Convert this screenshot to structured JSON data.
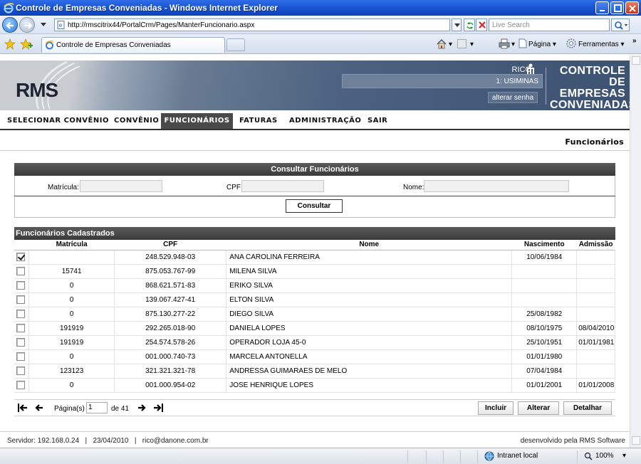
{
  "browser": {
    "window_title": "Controle de Empresas Conveniadas - Windows Internet Explorer",
    "url": "http://rmscitrix44/PortalCrm/Pages/ManterFuncionario.aspx",
    "search_placeholder": "Live Search",
    "tab_label": "Controle de Empresas Conveniadas",
    "cmd_page": "Página",
    "cmd_tools": "Ferramentas",
    "status_zone": "Intranet local",
    "status_zoom": "100%"
  },
  "header": {
    "logo": "RMS",
    "username": "RICO",
    "company": "1: USIMINAS",
    "change_password": "alterar senha",
    "system_name_1": "CONTROLE",
    "system_name_2": "DE EMPRESAS",
    "system_name_3": "CONVENIADAS"
  },
  "menu": {
    "items": [
      "SELECIONAR CONVÊNIO",
      "CONVÊNIO",
      "FUNCIONÁRIOS",
      "FATURAS",
      "ADMINISTRAÇÃO",
      "SAIR"
    ],
    "active_index": 2
  },
  "page_title": "Funcionários",
  "search": {
    "title": "Consultar Funcionários",
    "matricula_label": "Matrícula:",
    "cpf_label": "CPF:",
    "nome_label": "Nome:",
    "button": "Consultar"
  },
  "results": {
    "title": "Funcionários Cadastrados",
    "columns": [
      "Matrícula",
      "CPF",
      "Nome",
      "Nascimento",
      "Admissão"
    ],
    "rows": [
      {
        "checked": true,
        "matricula": "",
        "cpf": "248.529.948-03",
        "nome": "ANA CAROLINA FERREIRA",
        "nascimento": "10/06/1984",
        "admissao": ""
      },
      {
        "checked": false,
        "matricula": "15741",
        "cpf": "875.053.767-99",
        "nome": "MILENA SILVA",
        "nascimento": "",
        "admissao": ""
      },
      {
        "checked": false,
        "matricula": "0",
        "cpf": "868.621.571-83",
        "nome": "ERIKO SILVA",
        "nascimento": "",
        "admissao": ""
      },
      {
        "checked": false,
        "matricula": "0",
        "cpf": "139.067.427-41",
        "nome": "ELTON SILVA",
        "nascimento": "",
        "admissao": ""
      },
      {
        "checked": false,
        "matricula": "0",
        "cpf": "875.130.277-22",
        "nome": "DIEGO SILVA",
        "nascimento": "25/08/1982",
        "admissao": ""
      },
      {
        "checked": false,
        "matricula": "191919",
        "cpf": "292.265.018-90",
        "nome": "DANIELA LOPES",
        "nascimento": "08/10/1975",
        "admissao": "08/04/2010"
      },
      {
        "checked": false,
        "matricula": "191919",
        "cpf": "254.574.578-26",
        "nome": "OPERADOR LOJA 45-0",
        "nascimento": "25/10/1951",
        "admissao": "01/01/1981"
      },
      {
        "checked": false,
        "matricula": "0",
        "cpf": "001.000.740-73",
        "nome": "MARCELA ANTONELLA",
        "nascimento": "01/01/1980",
        "admissao": ""
      },
      {
        "checked": false,
        "matricula": "123123",
        "cpf": "321.321.321-78",
        "nome": "ANDRESSA GUIMARAES DE MELO",
        "nascimento": "07/04/1984",
        "admissao": ""
      },
      {
        "checked": false,
        "matricula": "0",
        "cpf": "001.000.954-02",
        "nome": "JOSE HENRIQUE LOPES",
        "nascimento": "01/01/2001",
        "admissao": "01/01/2008"
      }
    ],
    "pager": {
      "label": "Página(s)",
      "current": "1",
      "total": "de 41"
    },
    "buttons": {
      "incluir": "Incluir",
      "alterar": "Alterar",
      "detalhar": "Detalhar"
    }
  },
  "footer": {
    "left": "Servidor: 192.168.0.24   |   23/04/2010   |   rico@danone.com.br",
    "right": "desenvolvido pela RMS Software"
  }
}
